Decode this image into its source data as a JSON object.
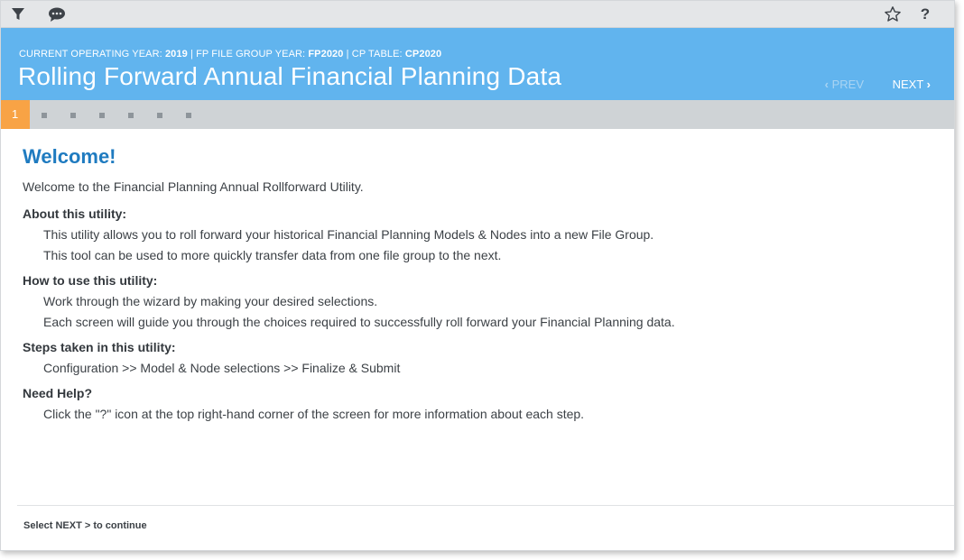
{
  "toolbar": {
    "icons": [
      "filter-icon",
      "comment-icon",
      "star-icon",
      "help-icon"
    ],
    "help_label": "?"
  },
  "header": {
    "current_year_label": "CURRENT OPERATING YEAR:",
    "current_year_value": "2019",
    "fp_group_label": "FP FILE GROUP YEAR:",
    "fp_group_value": "FP2020",
    "cp_table_label": "CP TABLE:",
    "cp_table_value": "CP2020",
    "separator": "|",
    "title": "Rolling Forward Annual Financial Planning Data",
    "prev_label": "PREV",
    "next_label": "NEXT"
  },
  "steps": {
    "active": "1",
    "total": 7
  },
  "content": {
    "heading": "Welcome!",
    "intro": "Welcome to the Financial Planning Annual Rollforward Utility.",
    "sections": [
      {
        "title": "About this utility:",
        "lines": [
          "This utility allows you to roll forward your historical Financial Planning Models & Nodes into a new File Group.",
          "This tool can be used to more quickly transfer data from one file group to the next."
        ]
      },
      {
        "title": "How to use this utility:",
        "lines": [
          "Work through the wizard by making your desired selections.",
          "Each screen will guide you through the choices required to successfully roll forward your Financial Planning data."
        ]
      },
      {
        "title": "Steps taken in this utility:",
        "lines": [
          "Configuration >> Model & Node selections >> Finalize & Submit"
        ]
      },
      {
        "title": "Need Help?",
        "lines": [
          "Click the \"?\" icon at the top right-hand corner of the screen for more information about each step."
        ]
      }
    ],
    "footer_note": "Select NEXT > to continue"
  },
  "colors": {
    "header_bg": "#61b4ee",
    "step_active": "#f8a345",
    "heading": "#1f7bc0"
  }
}
